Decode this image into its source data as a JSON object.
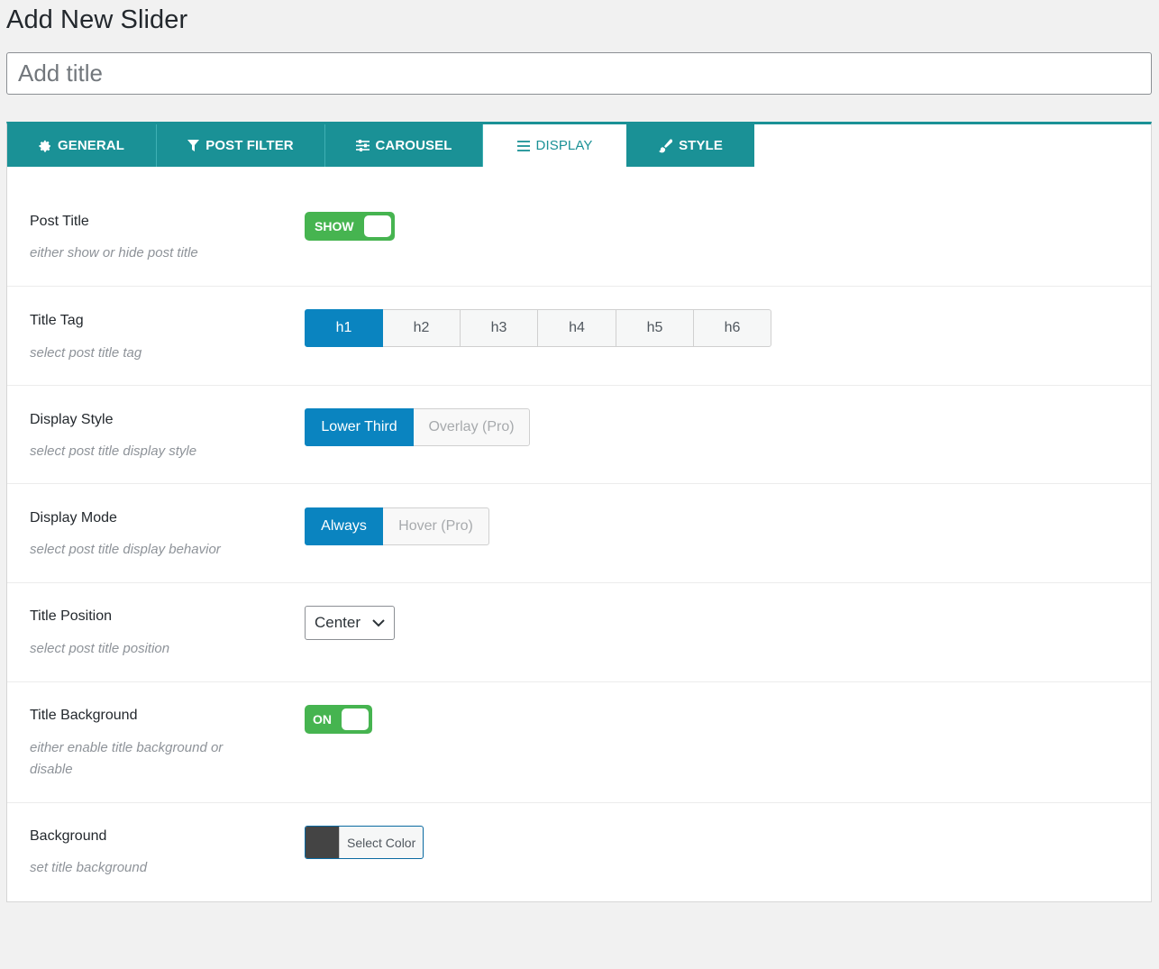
{
  "page": {
    "title": "Add New Slider",
    "title_placeholder": "Add title"
  },
  "tabs": [
    {
      "label": "GENERAL",
      "icon": "gear-icon",
      "active": false
    },
    {
      "label": "POST FILTER",
      "icon": "filter-icon",
      "active": false
    },
    {
      "label": "CAROUSEL",
      "icon": "sliders-icon",
      "active": false
    },
    {
      "label": "DISPLAY",
      "icon": "list-icon",
      "active": true
    },
    {
      "label": "STYLE",
      "icon": "brush-icon",
      "active": false
    }
  ],
  "settings": {
    "post_title": {
      "label": "Post Title",
      "desc": "either show or hide post title",
      "toggle": "SHOW"
    },
    "title_tag": {
      "label": "Title Tag",
      "desc": "select post title tag",
      "options": [
        "h1",
        "h2",
        "h3",
        "h4",
        "h5",
        "h6"
      ],
      "selected": "h1"
    },
    "display_style": {
      "label": "Display Style",
      "desc": "select post title display style",
      "options": [
        "Lower Third",
        "Overlay (Pro)"
      ],
      "selected": "Lower Third"
    },
    "display_mode": {
      "label": "Display Mode",
      "desc": "select post title display behavior",
      "options": [
        "Always",
        "Hover (Pro)"
      ],
      "selected": "Always"
    },
    "title_position": {
      "label": "Title Position",
      "desc": "select post title position",
      "value": "Center"
    },
    "title_background": {
      "label": "Title Background",
      "desc": "either enable title background or disable",
      "toggle": "ON"
    },
    "background": {
      "label": "Background",
      "desc": "set title background",
      "button": "Select Color",
      "color": "#444444"
    }
  },
  "colors": {
    "tab_bg": "#1a9196",
    "toggle_on": "#46b450",
    "segment_active": "#0a84c0"
  }
}
